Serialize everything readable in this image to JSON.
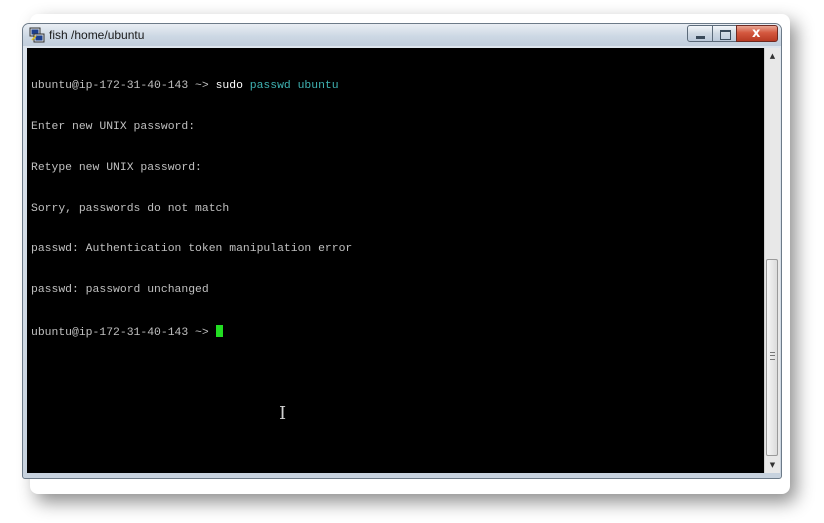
{
  "window": {
    "title": "fish  /home/ubuntu",
    "icon": "putty-terminal-icon",
    "controls": {
      "minimize_icon": "minimize-icon",
      "maximize_icon": "maximize-icon",
      "close_label": "x"
    }
  },
  "terminal": {
    "command_line": {
      "prompt": "ubuntu@ip-172-31-40-143 ~> ",
      "command": "sudo",
      "args": " passwd ubuntu"
    },
    "output_lines": [
      "Enter new UNIX password:",
      "Retype new UNIX password:",
      "Sorry, passwords do not match",
      "passwd: Authentication token manipulation error",
      "passwd: password unchanged"
    ],
    "current_prompt": "ubuntu@ip-172-31-40-143 ~> ",
    "colors": {
      "background": "#000000",
      "text": "#c0c0c0",
      "command": "#ffffff",
      "argument": "#3fb3b3",
      "cursor": "#22dd22"
    }
  },
  "scrollbar": {
    "up_arrow": "▲",
    "down_arrow": "▼"
  }
}
